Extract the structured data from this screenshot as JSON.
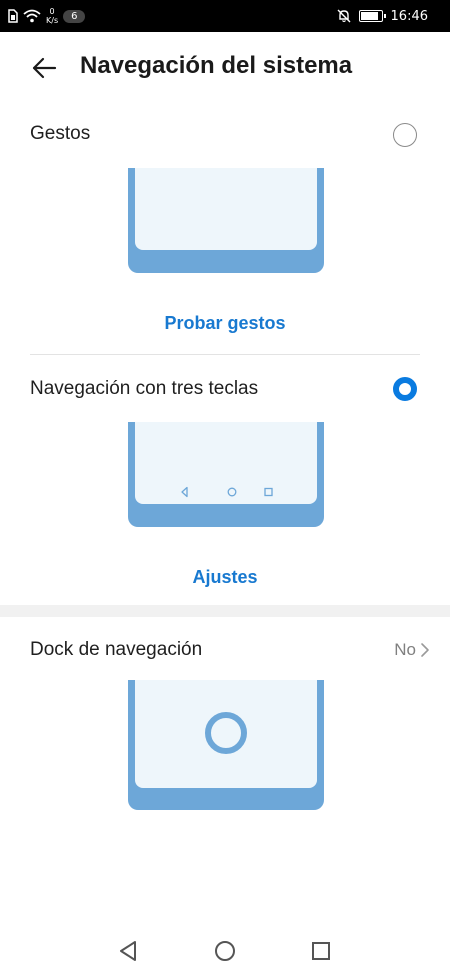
{
  "status_bar": {
    "speed_value": "0",
    "speed_unit": "K/s",
    "notification_count": "6",
    "time": "16:46",
    "battery_level": 0.9,
    "icons": [
      "sim-icon",
      "wifi-icon",
      "mute-bell-icon",
      "battery-icon"
    ]
  },
  "header": {
    "title": "Navegación del sistema",
    "back_icon": "arrow-left-icon"
  },
  "options": [
    {
      "label": "Gestos",
      "selected": false,
      "action_label": "Probar gestos"
    },
    {
      "label": "Navegación con tres teclas",
      "selected": true,
      "action_label": "Ajustes"
    }
  ],
  "dock": {
    "label": "Dock de navegación",
    "value": "No",
    "chevron_icon": "chevron-right-icon"
  },
  "nav_bar": {
    "icons": [
      "back-triangle-icon",
      "home-circle-icon",
      "recents-square-icon"
    ]
  },
  "colors": {
    "accent": "#1879d0",
    "radio_selected": "#0a7be0",
    "phone_frame": "#6da7d8",
    "phone_screen": "#eef6fb"
  }
}
